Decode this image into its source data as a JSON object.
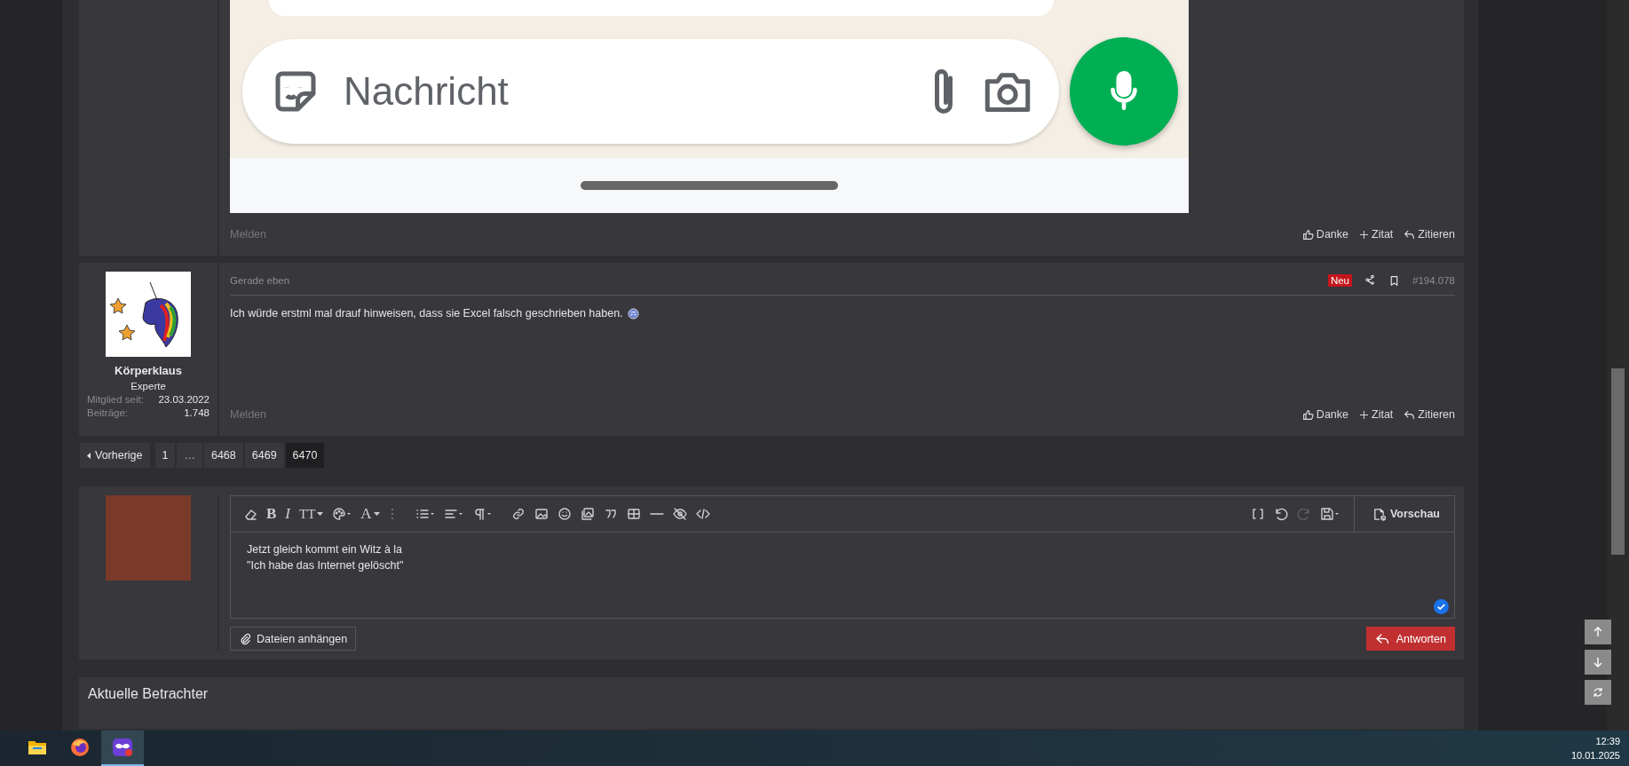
{
  "posts": [
    {
      "image": {
        "message_field": {
          "placeholder": "Nachricht"
        }
      },
      "footer": {
        "report": "Melden",
        "actions": [
          {
            "kind": "like",
            "label": "Danke"
          },
          {
            "kind": "plus",
            "label": "Zitat"
          },
          {
            "kind": "reply",
            "label": "Zitieren"
          }
        ]
      }
    },
    {
      "author": {
        "name": "Körperklaus",
        "title": "Experte",
        "stats": [
          {
            "label": "Mitglied seit:",
            "value": "23.03.2022"
          },
          {
            "label": "Beiträge:",
            "value": "1.748"
          }
        ]
      },
      "date": "Gerade eben",
      "badge": "Neu",
      "number": "#194.078",
      "body": "Ich würde erstml mal drauf hinweisen, dass sie Excel falsch geschrieben haben.",
      "footer": {
        "report": "Melden",
        "actions": [
          {
            "kind": "like",
            "label": "Danke"
          },
          {
            "kind": "plus",
            "label": "Zitat"
          },
          {
            "kind": "reply",
            "label": "Zitieren"
          }
        ]
      }
    }
  ],
  "pagination": {
    "previous": "Vorherige",
    "pages": [
      {
        "kind": "page",
        "label": "1",
        "selected": false
      },
      {
        "kind": "ellipsis",
        "label": "…",
        "selected": false
      },
      {
        "kind": "page",
        "label": "6468",
        "selected": false
      },
      {
        "kind": "page",
        "label": "6469",
        "selected": false
      },
      {
        "kind": "page",
        "label": "6470",
        "selected": true
      }
    ]
  },
  "editor": {
    "toolbar_left": [
      [
        {
          "kind": "eraser",
          "disabled": false
        },
        {
          "kind": "bold",
          "glyph": "B",
          "disabled": false
        },
        {
          "kind": "italic",
          "glyph": "I",
          "disabled": false
        },
        {
          "kind": "size",
          "glyph": "TT",
          "disabled": false
        },
        {
          "kind": "palette",
          "disabled": false
        },
        {
          "kind": "font",
          "glyph": "A",
          "disabled": false
        },
        {
          "kind": "more",
          "disabled": false
        }
      ],
      [
        {
          "kind": "list",
          "disabled": false
        },
        {
          "kind": "align",
          "disabled": false
        },
        {
          "kind": "paragraph",
          "disabled": false
        }
      ],
      [
        {
          "kind": "link",
          "disabled": false
        },
        {
          "kind": "image",
          "disabled": false
        },
        {
          "kind": "smiley",
          "disabled": false
        },
        {
          "kind": "media",
          "disabled": false
        },
        {
          "kind": "quote",
          "disabled": false
        },
        {
          "kind": "table",
          "disabled": false
        },
        {
          "kind": "rule",
          "disabled": false
        },
        {
          "kind": "hidden",
          "disabled": false
        },
        {
          "kind": "code",
          "disabled": false
        }
      ]
    ],
    "toolbar_right": [
      {
        "kind": "brackets",
        "disabled": false
      },
      {
        "kind": "undo",
        "disabled": false
      },
      {
        "kind": "redo",
        "disabled": true
      },
      {
        "kind": "save",
        "disabled": false
      }
    ],
    "preview": "Vorschau",
    "lines": [
      "Jetzt gleich kommt ein Witz à la",
      "\"Ich habe das Internet gelöscht\""
    ],
    "attach": "Dateien anhängen",
    "submit": "Antworten"
  },
  "viewers": {
    "title": "Aktuelle Betrachter"
  },
  "taskbar": {
    "apps": [
      {
        "kind": "explorer",
        "selected": false
      },
      {
        "kind": "firefox",
        "selected": false
      },
      {
        "kind": "app",
        "selected": true
      }
    ],
    "time": "12:39",
    "date": "10.01.2025"
  }
}
